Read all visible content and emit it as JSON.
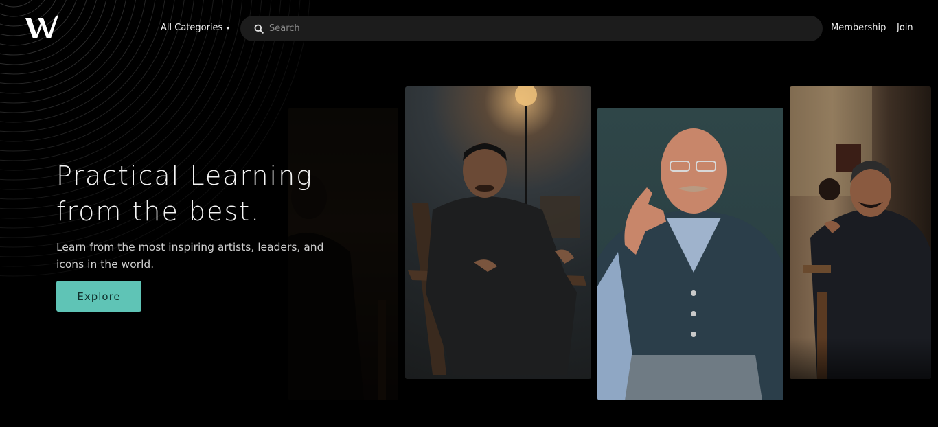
{
  "header": {
    "logo_icon": "w-logo-icon",
    "categories_label": "All Categories",
    "search": {
      "placeholder": "Search",
      "value": "",
      "icon": "search-icon"
    },
    "nav": {
      "membership_label": "Membership",
      "join_label": "Join"
    }
  },
  "hero": {
    "title_line1": "Practical Learning",
    "title_line2": "from the best.",
    "subtitle": "Learn from the most inspiring artists, leaders, and icons in the world.",
    "cta_label": "Explore"
  },
  "colors": {
    "background": "#000000",
    "accent": "#5fc4b6",
    "search_bg": "#1c1c1c"
  }
}
